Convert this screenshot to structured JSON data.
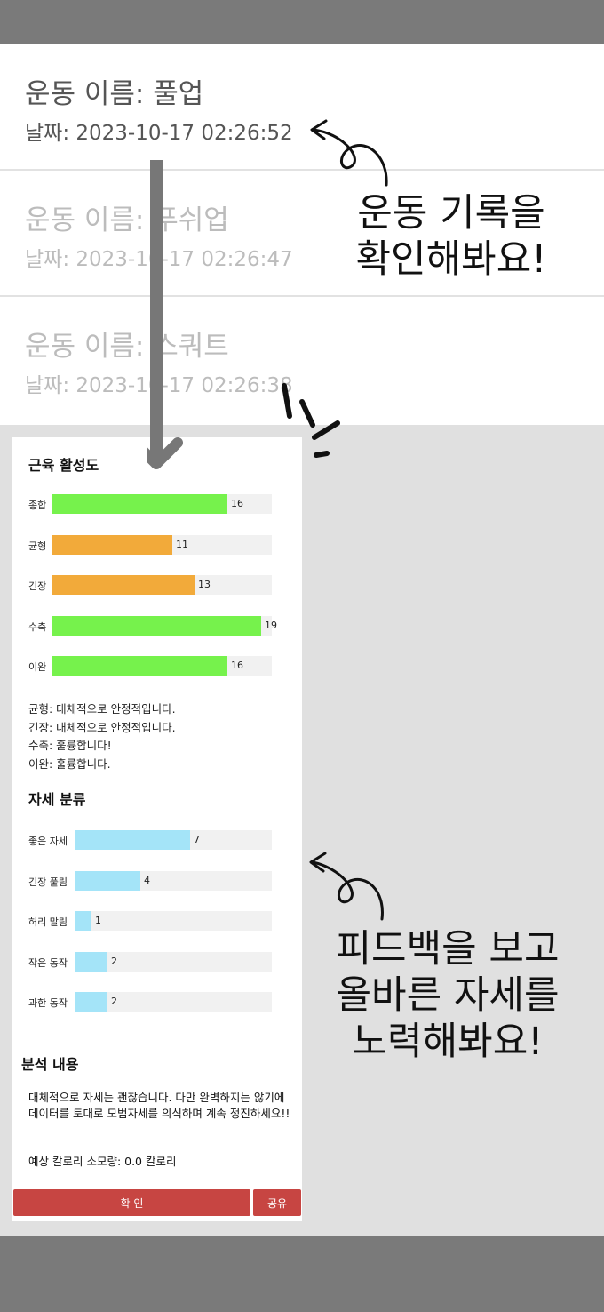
{
  "records": [
    {
      "name": "운동 이름: 풀업",
      "date": "날짜: 2023-10-17 02:26:52"
    },
    {
      "name": "운동 이름: 푸쉬업",
      "date": "날짜: 2023-10-17 02:26:47"
    },
    {
      "name": "운동 이름: 스쿼트",
      "date": "날짜: 2023-10-17 02:26:38"
    }
  ],
  "muscle": {
    "title": "근육 활성도",
    "colors": {
      "good": "#76f24c",
      "warn": "#f2aa3a"
    },
    "bars": [
      {
        "label": "종합",
        "value": 16,
        "color": "#76f24c"
      },
      {
        "label": "균형",
        "value": 11,
        "color": "#f2aa3a"
      },
      {
        "label": "긴장",
        "value": 13,
        "color": "#f2aa3a"
      },
      {
        "label": "수축",
        "value": 19,
        "color": "#76f24c"
      },
      {
        "label": "이완",
        "value": 16,
        "color": "#76f24c"
      }
    ],
    "feedback": [
      "균형: 대체적으로 안정적입니다.",
      "긴장: 대체적으로 안정적입니다.",
      "수축: 훌륭합니다!",
      "이완: 훌륭합니다."
    ]
  },
  "posture": {
    "title": "자세 분류",
    "color": "#a4e4f8",
    "bars": [
      {
        "label": "좋은 자세",
        "value": 7
      },
      {
        "label": "긴장 풀림",
        "value": 4
      },
      {
        "label": "허리 말림",
        "value": 1
      },
      {
        "label": "작은 동작",
        "value": 2
      },
      {
        "label": "과한 동작",
        "value": 2
      }
    ]
  },
  "analysis": {
    "title": "분석 내용",
    "text": "대체적으로 자세는 괜찮습니다. 다만 완벽하지는 않기에 데이터를 토대로 모범자세를 의식하며 계속 정진하세요!!",
    "calorie": "예상 칼로리 소모량: 0.0 칼로리"
  },
  "buttons": {
    "confirm": "확    인",
    "share": "공유",
    "color": "#c74542"
  },
  "annotations": {
    "top": [
      "운동 기록을",
      "확인해봐요!"
    ],
    "bottom": [
      "피드백을 보고",
      "올바른 자세를",
      "노력해봐요!"
    ]
  }
}
